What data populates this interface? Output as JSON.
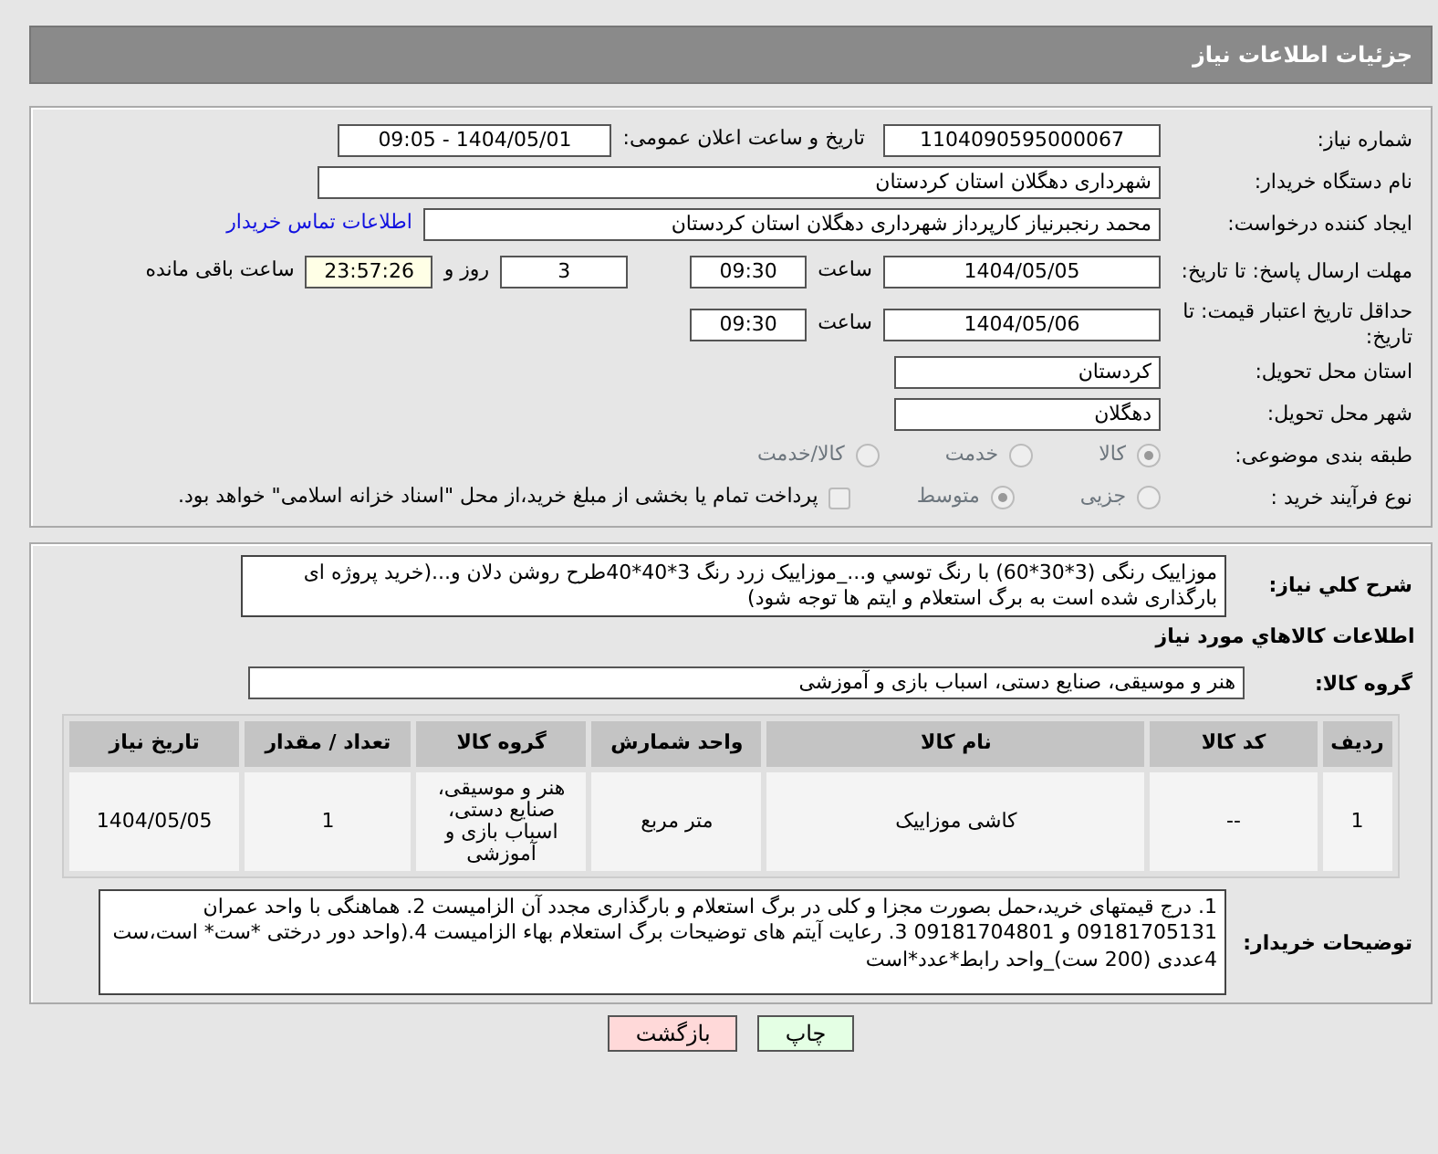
{
  "header": {
    "title": "جزئیات اطلاعات نیاز"
  },
  "need_number": {
    "label": "شماره نیاز:",
    "value": "1104090595000067"
  },
  "announce": {
    "label": "تاریخ و ساعت اعلان عمومی:",
    "value": "1404/05/01 - 09:05"
  },
  "buyer": {
    "label": "نام دستگاه خریدار:",
    "value": "شهرداری دهگلان استان کردستان"
  },
  "requester": {
    "label": "ایجاد کننده درخواست:",
    "value": "محمد رنجبرنیاز کارپرداز شهرداری دهگلان استان کردستان",
    "link": "اطلاعات تماس خریدار"
  },
  "reply_deadline": {
    "label": "مهلت ارسال پاسخ: تا تاریخ:",
    "date": "1404/05/05",
    "time_label": "ساعت",
    "time": "09:30",
    "days": "3",
    "days_label": "روز و",
    "remaining": "23:57:26",
    "remaining_label": "ساعت باقی مانده"
  },
  "price_validity": {
    "label": "حداقل تاریخ اعتبار قیمت: تا تاریخ:",
    "date": "1404/05/06",
    "time_label": "ساعت",
    "time": "09:30"
  },
  "province": {
    "label": "استان محل تحویل:",
    "value": "کردستان"
  },
  "city": {
    "label": "شهر محل تحویل:",
    "value": "دهگلان"
  },
  "category": {
    "label": "طبقه بندی موضوعی:",
    "options": [
      {
        "label": "کالا",
        "selected": true
      },
      {
        "label": "خدمت",
        "selected": false
      },
      {
        "label": "کالا/خدمت",
        "selected": false
      }
    ]
  },
  "process": {
    "label": "نوع فرآیند خرید :",
    "options": [
      {
        "label": "جزیی",
        "selected": false
      },
      {
        "label": "متوسط",
        "selected": true
      }
    ],
    "payment": {
      "checked": false,
      "text": "پرداخت تمام یا بخشی از مبلغ خرید،از محل \"اسناد خزانه اسلامی\" خواهد بود."
    }
  },
  "description": {
    "label": "شرح کلي نياز:",
    "value": "موزاییک رنگی (3*30*60) با رنگ توسي و..._موزاییک زرد رنگ 3*40*40طرح روشن دلان و...(خرید پروژه ای بارگذاری شده است به برگ استعلام و ایتم ها توجه شود)"
  },
  "goods_heading": "اطلاعات کالاهاي مورد نياز",
  "goods_group": {
    "label": "گروه کالا:",
    "value": "هنر و موسیقی، صنایع دستی، اسباب بازی و آموزشی"
  },
  "table": {
    "columns": [
      "ردیف",
      "کد کالا",
      "نام کالا",
      "واحد شمارش",
      "گروه کالا",
      "تعداد / مقدار",
      "تاریخ نیاز"
    ],
    "rows": [
      [
        "1",
        "--",
        "کاشی موزاییک",
        "متر مربع",
        "هنر و موسیقی، صنایع دستی، اسباب بازی و آموزشی",
        "1",
        "1404/05/05"
      ]
    ]
  },
  "buyer_notes": {
    "label": "توضیحات خریدار:",
    "value": "1. درج قیمتهای خرید،حمل بصورت مجزا و کلی در برگ استعلام و بارگذاری مجدد آن الزامیست 2. هماهنگی با واحد عمران 09181705131 و 09181704801 3. رعایت آیتم های توضیحات برگ استعلام بهاء الزامیست 4.(واحد دور درختی *ست* است،ست 4عددی (200 ست)_واحد رابط*عدد*است"
  },
  "buttons": [
    {
      "label": "چاپ",
      "kind": "print"
    },
    {
      "label": "بازگشت",
      "kind": "back"
    }
  ]
}
